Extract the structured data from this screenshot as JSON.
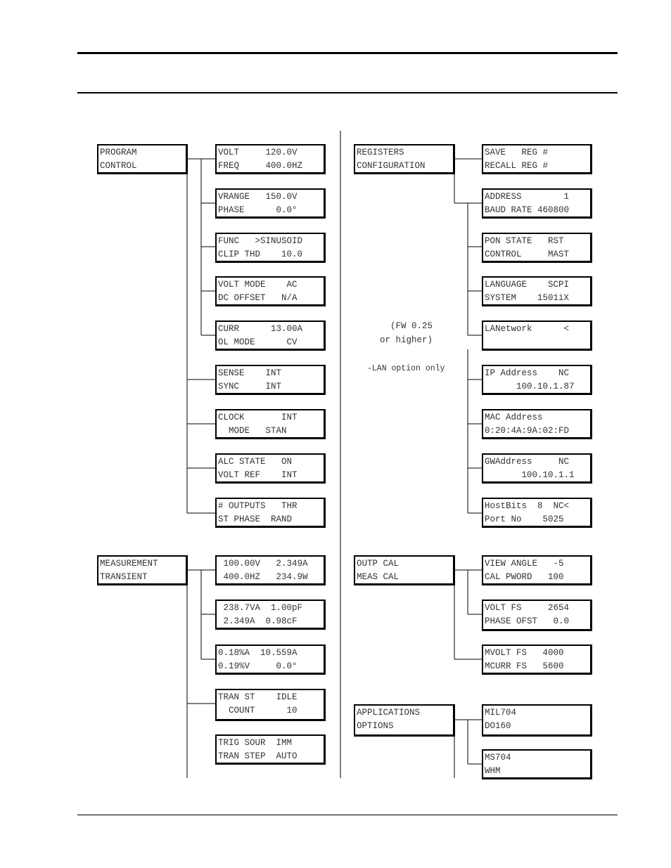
{
  "menus": {
    "program_control": {
      "title": [
        "PROGRAM",
        "CONTROL"
      ],
      "screens": [
        [
          "VOLT     120.0V",
          "FREQ     400.0HZ"
        ],
        [
          "VRANGE   150.0V",
          "PHASE      0.0°"
        ],
        [
          "FUNC   >SINUSOID",
          "CLIP THD    10.0"
        ],
        [
          "VOLT MODE    AC",
          "DC OFFSET   N/A"
        ],
        [
          "CURR      13.00A",
          "OL MODE      CV"
        ],
        [
          "SENSE    INT",
          "SYNC     INT"
        ],
        [
          "CLOCK       INT",
          "  MODE   STAN"
        ],
        [
          "ALC STATE   ON",
          "VOLT REF    INT"
        ],
        [
          "# OUTPUTS   THR",
          "ST PHASE  RAND"
        ]
      ]
    },
    "measurement_transient": {
      "title": [
        "MEASUREMENT",
        "TRANSIENT"
      ],
      "screens": [
        [
          " 100.00V   2.349A",
          " 400.0HZ   234.9W"
        ],
        [
          " 238.7VA  1.00pF",
          " 2.349A  0.98cF"
        ],
        [
          "0.18%A  10.559A",
          "0.19%V     0.0°"
        ],
        [
          "TRAN ST    IDLE",
          "  COUNT      10"
        ],
        [
          "TRIG SOUR  IMM",
          "TRAN STEP  AUTO"
        ]
      ]
    },
    "registers_configuration": {
      "title": [
        "REGISTERS",
        "CONFIGURATION"
      ],
      "screens": [
        [
          "SAVE   REG #",
          "RECALL REG #"
        ],
        [
          "ADDRESS        1",
          "BAUD RATE 460800"
        ],
        [
          "PON STATE   RST",
          "CONTROL     MAST"
        ],
        [
          "LANGUAGE    SCPI",
          "SYSTEM    1501iX"
        ],
        [
          "LANetwork      <",
          ""
        ],
        [
          "IP Address    NC",
          "      100.10.1.87"
        ],
        [
          "MAC Address",
          "0:20:4A:9A:02:FD"
        ],
        [
          "GWAddress     NC",
          "       100.10.1.1"
        ],
        [
          "HostBits  8  NC<",
          "Port No    5025"
        ]
      ],
      "notes": {
        "firmware": "(FW 0.25\nor higher)",
        "lan_option": "-LAN option only"
      }
    },
    "calibration": {
      "title": [
        "OUTP CAL",
        "MEAS CAL"
      ],
      "screens": [
        [
          "VIEW ANGLE   -5",
          "CAL PWORD   100"
        ],
        [
          "VOLT FS     2654",
          "PHASE OFST   0.0"
        ],
        [
          "MVOLT FS   4000",
          "MCURR FS   5600"
        ]
      ]
    },
    "applications_options": {
      "title": [
        "APPLICATIONS",
        "OPTIONS"
      ],
      "screens": [
        [
          "MIL704",
          "DO160"
        ],
        [
          "MS704",
          "WHM"
        ]
      ]
    }
  }
}
